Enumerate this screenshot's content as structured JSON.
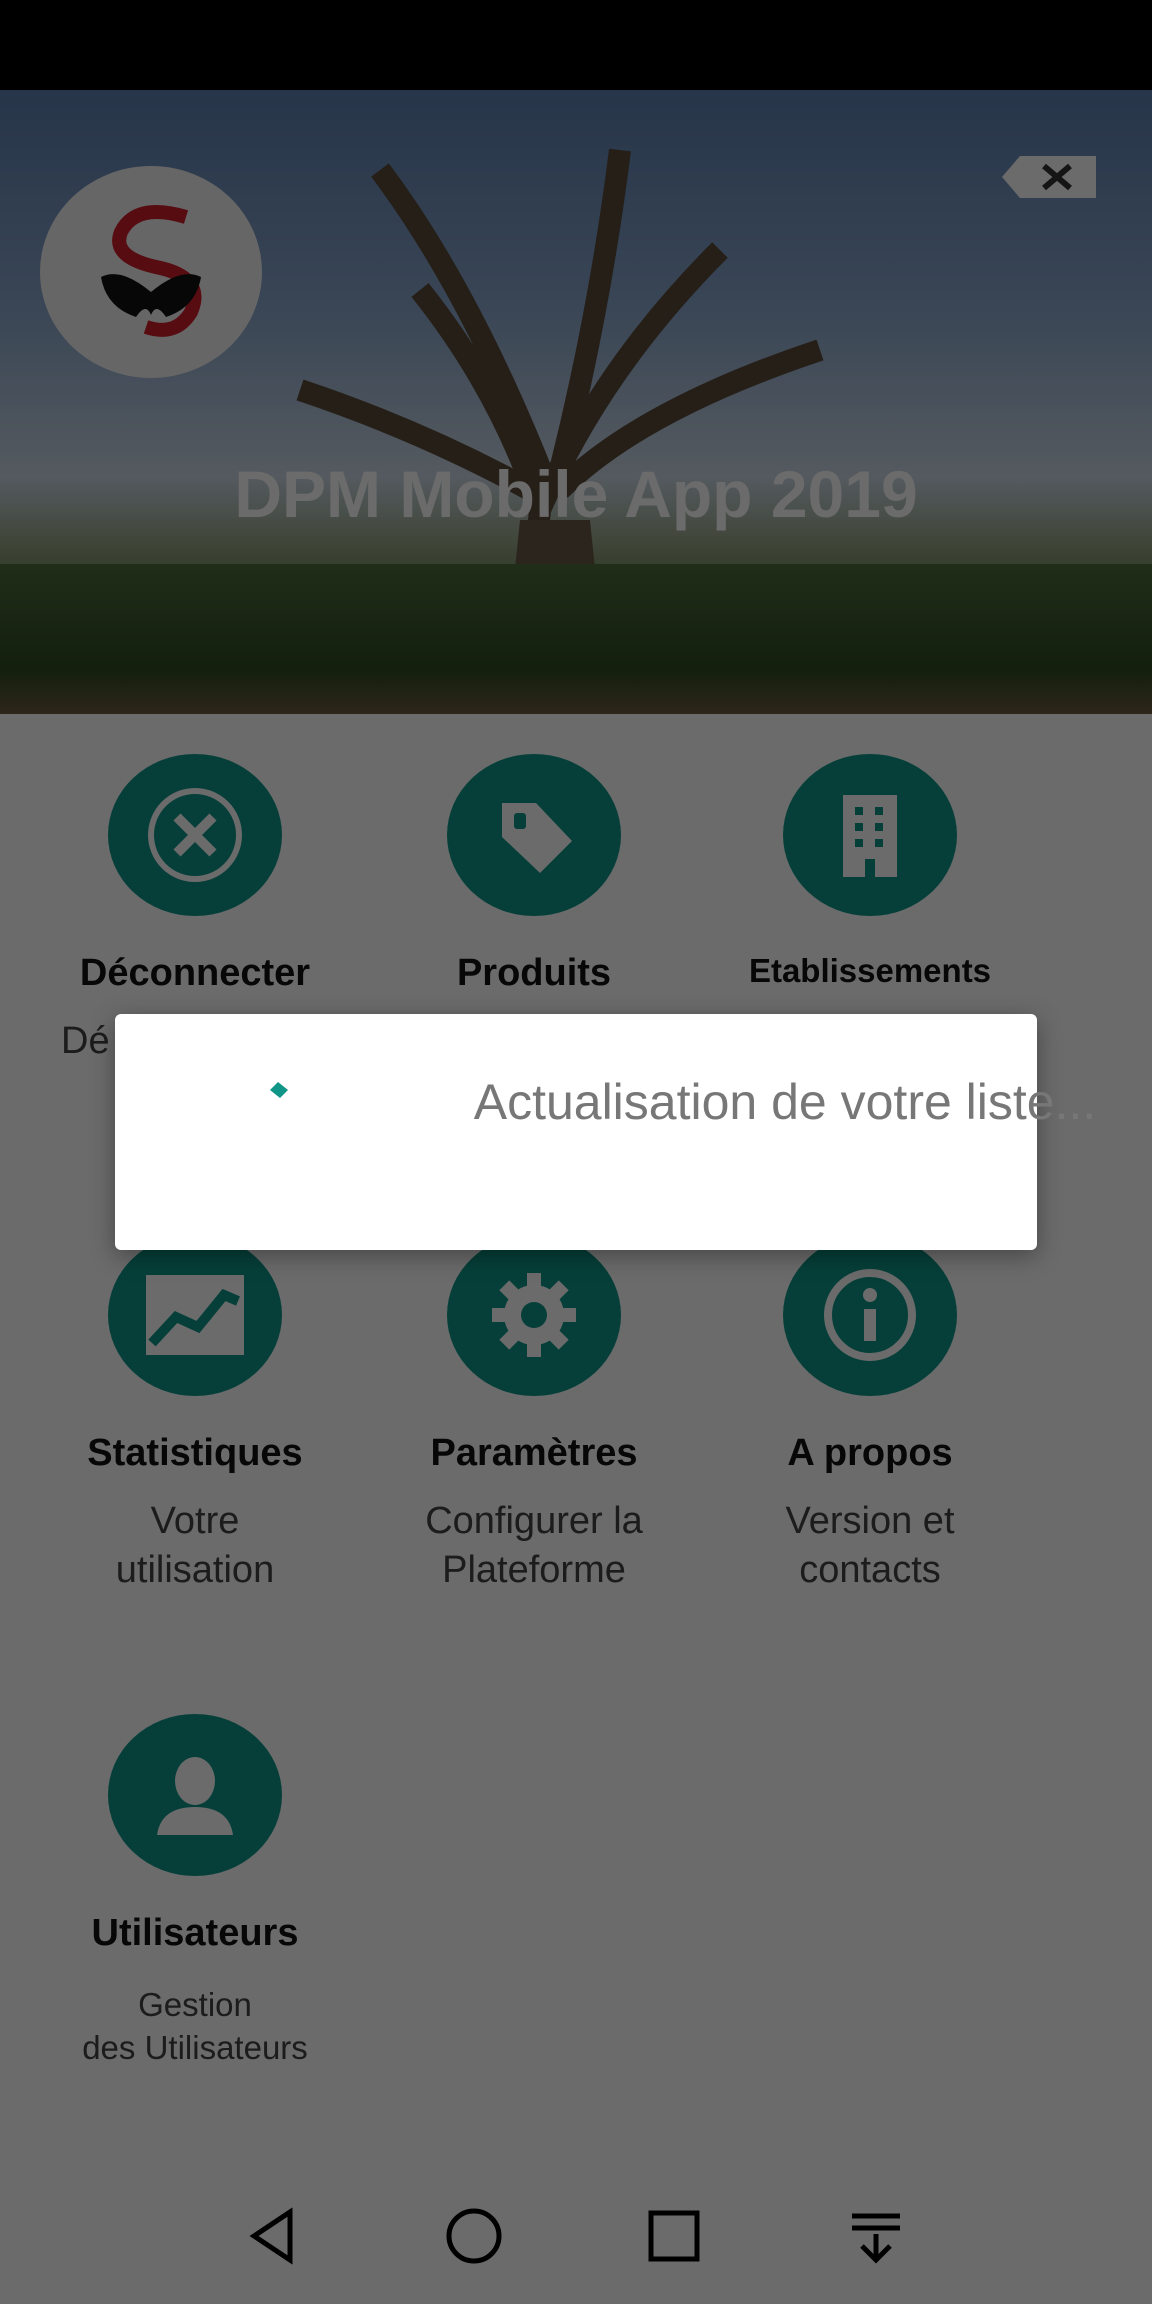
{
  "header": {
    "title": "DPM Mobile App 2019",
    "logo_icon": "snake-s-logo",
    "close_ad_icon": "close-icon"
  },
  "menu": {
    "items": [
      {
        "title": "Déconnecter",
        "subtitle": "Dé",
        "icon": "close-circle-icon"
      },
      {
        "title": "Produits",
        "subtitle": "",
        "icon": "tag-icon"
      },
      {
        "title": "Etablissements",
        "subtitle": "",
        "icon": "building-icon"
      },
      {
        "title": "Statistiques",
        "subtitle": "Votre\nutilisation",
        "icon": "chart-icon"
      },
      {
        "title": "Paramètres",
        "subtitle": "Configurer la\nPlateforme",
        "icon": "gear-icon"
      },
      {
        "title": "A propos",
        "subtitle": "Version et\ncontacts",
        "icon": "info-icon"
      },
      {
        "title": "Utilisateurs",
        "subtitle": "Gestion\ndes Utilisateurs",
        "icon": "user-icon"
      }
    ]
  },
  "dialog": {
    "message": "Actualisation de votre liste..."
  },
  "nav": {
    "back_icon": "back-triangle-icon",
    "home_icon": "home-circle-icon",
    "recents_icon": "recents-square-icon",
    "notifications_icon": "pull-down-icon"
  },
  "colors": {
    "accent": "#0f9688",
    "scrim": "#000000"
  }
}
